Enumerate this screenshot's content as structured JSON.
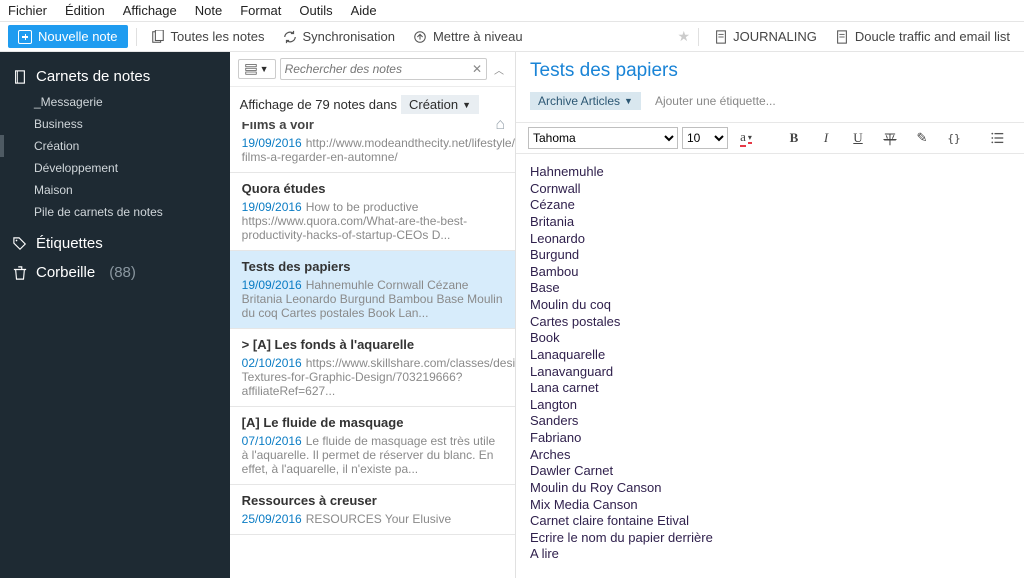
{
  "menu": [
    "Fichier",
    "Édition",
    "Affichage",
    "Note",
    "Format",
    "Outils",
    "Aide"
  ],
  "toolbar": {
    "new_note": "Nouvelle note",
    "all_notes": "Toutes les notes",
    "sync": "Synchronisation",
    "upgrade": "Mettre à niveau",
    "shortcut1": "JOURNALING",
    "shortcut2": "Doucle traffic and email list"
  },
  "sidebar": {
    "notebooks_label": "Carnets de notes",
    "notebooks": [
      "_Messagerie",
      "Business",
      "Création",
      "Développement",
      "Maison",
      "Pile de carnets de notes"
    ],
    "tags_label": "Étiquettes",
    "trash_label": "Corbeille",
    "trash_count": "(88)"
  },
  "list": {
    "search_placeholder": "Rechercher des notes",
    "summary_prefix": "Affichage de 79 notes dans",
    "filter": "Création",
    "items": [
      {
        "title": "Films a voir",
        "date": "19/09/2016",
        "preview": "http://www.modeandthecity.net/lifestyle/les-films-a-regarder-en-automne/"
      },
      {
        "title": "Quora études",
        "date": "19/09/2016",
        "preview": "How to be productive https://www.quora.com/What-are-the-best-productivity-hacks-of-startup-CEOs D..."
      },
      {
        "title": "Tests des papiers",
        "date": "19/09/2016",
        "preview": "Hahnemuhle Cornwall Cézane Britania Leonardo Burgund Bambou Base Moulin du coq Cartes postales Book Lan...",
        "selected": true
      },
      {
        "title": "> [A] Les fonds à l'aquarelle",
        "date": "02/10/2016",
        "preview": "https://www.skillshare.com/classes/design/Watercolor-Textures-for-Graphic-Design/703219666?affiliateRef=627..."
      },
      {
        "title": "[A] Le fluide de masquage",
        "date": "07/10/2016",
        "preview": "Le fluide de masquage est très utile à l'aquarelle. Il permet de réserver du blanc. En effet, à l'aquarelle, il n'existe pa..."
      },
      {
        "title": "Ressources à creuser",
        "date": "25/09/2016",
        "preview": "RESOURCES Your Elusive"
      }
    ]
  },
  "note": {
    "title": "Tests des papiers",
    "tag": "Archive Articles",
    "add_tag": "Ajouter une étiquette...",
    "font": "Tahoma",
    "size": "10",
    "body": [
      "Hahnemuhle",
      "Cornwall",
      "Cézane",
      "Britania",
      "Leonardo",
      "Burgund",
      "Bambou",
      "Base",
      "Moulin du coq",
      "Cartes postales",
      "Book",
      "Lanaquarelle",
      "Lanavanguard",
      "Lana carnet",
      "Langton",
      "Sanders",
      "Fabriano",
      "Arches",
      "Dawler Carnet",
      "Moulin du Roy Canson",
      "Mix Media Canson",
      "Carnet claire fontaine Etival",
      "Ecrire le nom du papier derrière",
      "A lire"
    ]
  }
}
